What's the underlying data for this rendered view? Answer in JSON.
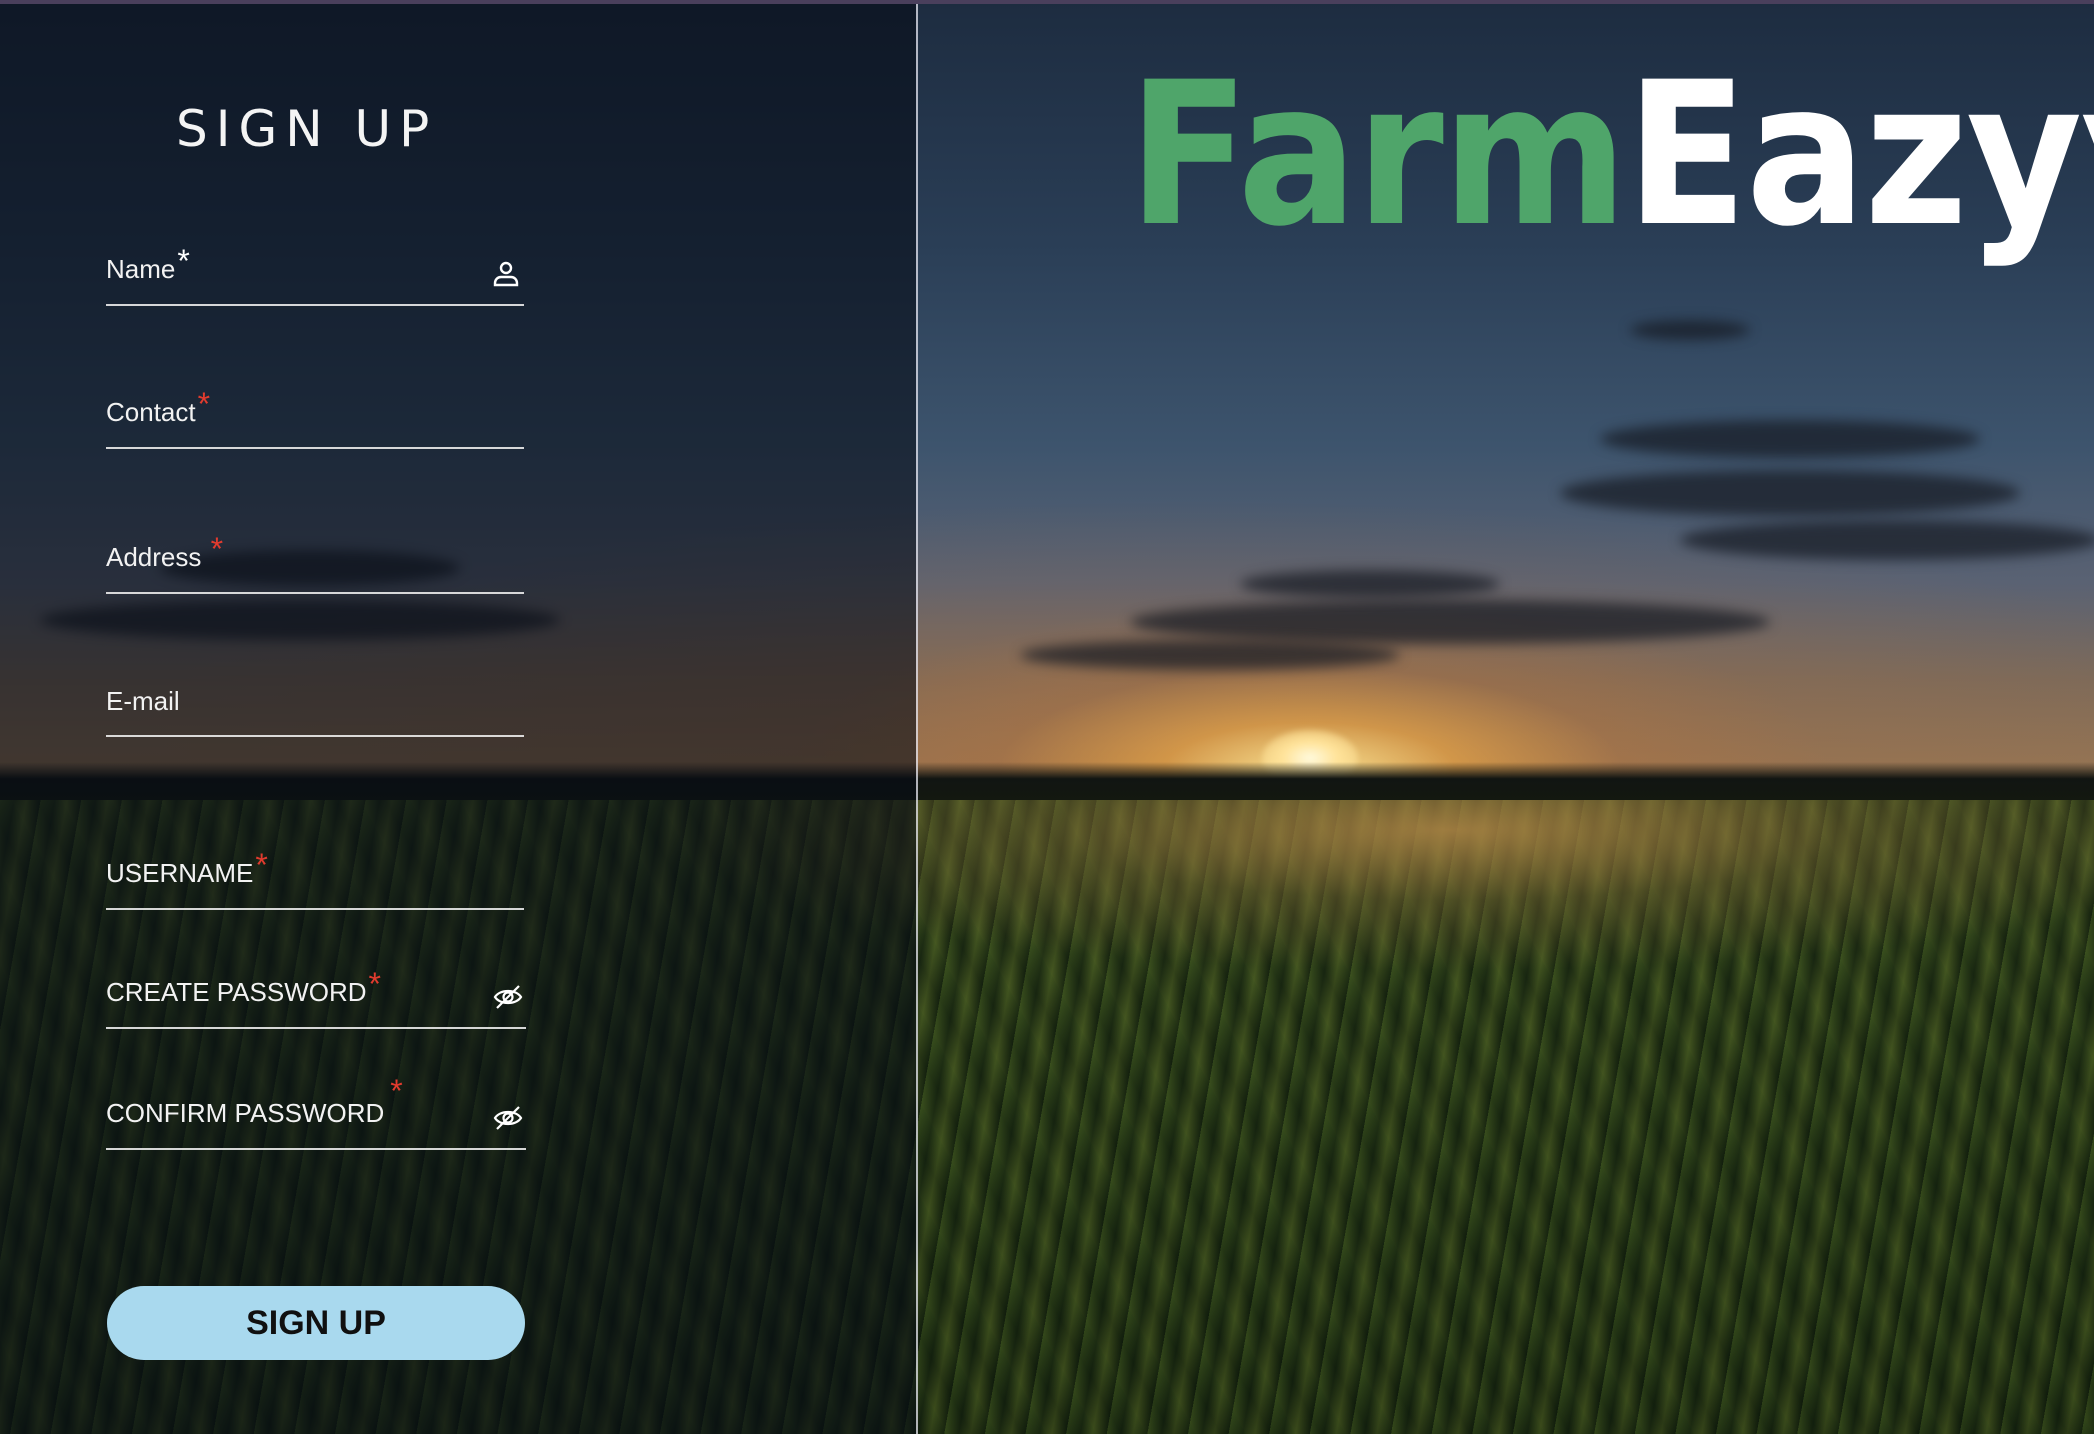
{
  "form": {
    "title": "SIGN UP",
    "fields": [
      {
        "label": "Name",
        "required_mark": "*",
        "icon": "user-icon"
      },
      {
        "label": "Contact",
        "required_mark": "*"
      },
      {
        "label": "Address",
        "required_mark": "*"
      },
      {
        "label": "E-mail"
      },
      {
        "label": "USERNAME",
        "required_mark": "*"
      },
      {
        "label": "CREATE PASSWORD",
        "required_mark": "*",
        "icon": "eye-off-icon"
      },
      {
        "label": "CONFIRM PASSWORD",
        "required_mark": "*",
        "icon": "eye-off-icon"
      }
    ],
    "submit_label": "SIGN UP"
  },
  "brand": {
    "part1": "Farm",
    "part2": "Eazyy",
    "part1_color": "#4fa56a",
    "part2_color": "#ffffff"
  },
  "colors": {
    "button_bg": "#a9d9ee",
    "required_red": "#e23b2e"
  }
}
